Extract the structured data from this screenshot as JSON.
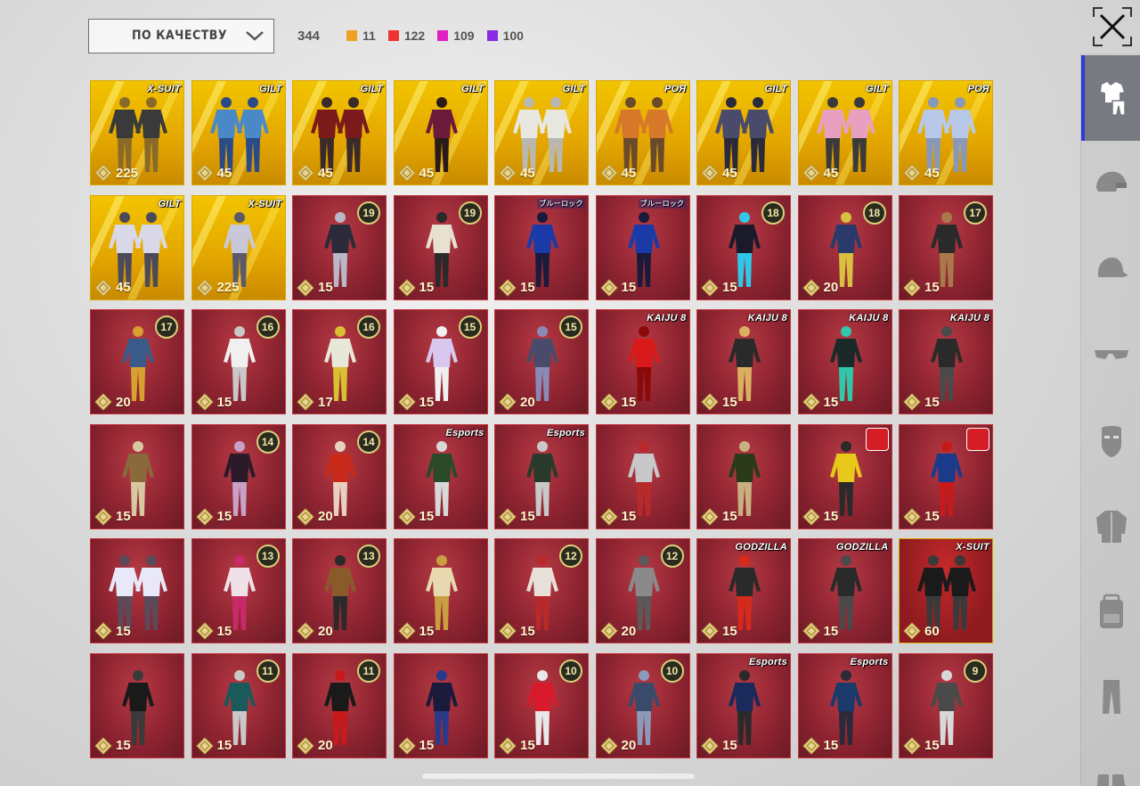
{
  "sort": {
    "label": "ПО КАЧЕСТВУ"
  },
  "stats": {
    "total": "344",
    "counts": [
      {
        "color": "#f0a020",
        "value": "11"
      },
      {
        "color": "#ee3333",
        "value": "122"
      },
      {
        "color": "#e020c0",
        "value": "109"
      },
      {
        "color": "#8a2be2",
        "value": "100"
      }
    ]
  },
  "sidebar": {
    "items": [
      {
        "icon": "outfit-icon",
        "active": true
      },
      {
        "icon": "helmet-icon",
        "active": false
      },
      {
        "icon": "cap-icon",
        "active": false
      },
      {
        "icon": "glasses-icon",
        "active": false
      },
      {
        "icon": "mask-icon",
        "active": false
      },
      {
        "icon": "jacket-icon",
        "active": false
      },
      {
        "icon": "backpack-icon",
        "active": false
      },
      {
        "icon": "pants-icon",
        "active": false
      },
      {
        "icon": "shoes-icon",
        "active": false
      }
    ]
  },
  "items": [
    {
      "price": "225",
      "tier": "gold",
      "brand": "X-SUIT",
      "brand_type": "text",
      "figures": 2,
      "colors": [
        "#3a3a3a",
        "#8a6a2a"
      ]
    },
    {
      "price": "45",
      "tier": "gold",
      "brand": "GILT",
      "brand_type": "text",
      "figures": 2,
      "colors": [
        "#4a88c8",
        "#2a4a88"
      ]
    },
    {
      "price": "45",
      "tier": "gold",
      "brand": "GILT",
      "brand_type": "text",
      "figures": 2,
      "colors": [
        "#7a1a1a",
        "#3a2a2a"
      ]
    },
    {
      "price": "45",
      "tier": "gold",
      "brand": "GILT",
      "brand_type": "text",
      "figures": 1,
      "colors": [
        "#6a1a3a",
        "#2a1a1a"
      ]
    },
    {
      "price": "45",
      "tier": "gold",
      "brand": "GILT",
      "brand_type": "text",
      "figures": 2,
      "colors": [
        "#e8e8e0",
        "#b8b8b0"
      ]
    },
    {
      "price": "45",
      "tier": "gold",
      "brand": "РОЯ",
      "brand_type": "text",
      "figures": 2,
      "colors": [
        "#d8782a",
        "#6a4a2a"
      ]
    },
    {
      "price": "45",
      "tier": "gold",
      "brand": "GILT",
      "brand_type": "text",
      "figures": 2,
      "colors": [
        "#4a4a6a",
        "#2a2a3a"
      ]
    },
    {
      "price": "45",
      "tier": "gold",
      "brand": "GILT",
      "brand_type": "text",
      "figures": 2,
      "colors": [
        "#e8a0c0",
        "#3a3a3a"
      ]
    },
    {
      "price": "45",
      "tier": "gold",
      "brand": "РОЯ",
      "brand_type": "text",
      "figures": 2,
      "colors": [
        "#b8c8e8",
        "#8898b8"
      ]
    },
    {
      "price": "45",
      "tier": "gold",
      "brand": "GILT",
      "brand_type": "text",
      "figures": 2,
      "colors": [
        "#d8d8e8",
        "#4a4a5a"
      ]
    },
    {
      "price": "225",
      "tier": "gold",
      "brand": "X-SUIT",
      "brand_type": "text",
      "figures": 1,
      "colors": [
        "#c8c8d8",
        "#5a5a6a"
      ]
    },
    {
      "price": "15",
      "tier": "red",
      "level": "19",
      "figures": 1,
      "colors": [
        "#2a2a3a",
        "#b8b8c8"
      ]
    },
    {
      "price": "15",
      "tier": "red",
      "level": "19",
      "figures": 1,
      "colors": [
        "#e8e0d0",
        "#2a2a2a"
      ]
    },
    {
      "price": "15",
      "tier": "red",
      "brand": "ブルーロック",
      "brand_type": "jp",
      "figures": 1,
      "colors": [
        "#1a3aa8",
        "#1a1a3a"
      ]
    },
    {
      "price": "15",
      "tier": "red",
      "brand": "ブルーロック",
      "brand_type": "jp",
      "figures": 1,
      "colors": [
        "#1a3aa8",
        "#1a1a3a"
      ]
    },
    {
      "price": "15",
      "tier": "red",
      "level": "18",
      "figures": 1,
      "colors": [
        "#1a1a2a",
        "#30c8e8"
      ]
    },
    {
      "price": "20",
      "tier": "red",
      "level": "18",
      "figures": 1,
      "colors": [
        "#2a3a6a",
        "#d8c040"
      ]
    },
    {
      "price": "15",
      "tier": "red",
      "level": "17",
      "figures": 1,
      "colors": [
        "#2a2a2a",
        "#a87a4a"
      ]
    },
    {
      "price": "20",
      "tier": "red",
      "level": "17",
      "figures": 1,
      "colors": [
        "#3a5a8a",
        "#d8a030"
      ]
    },
    {
      "price": "15",
      "tier": "red",
      "level": "16",
      "figures": 1,
      "colors": [
        "#f0f0f0",
        "#c8c8c8"
      ]
    },
    {
      "price": "17",
      "tier": "red",
      "level": "16",
      "figures": 1,
      "colors": [
        "#e8e8d8",
        "#d8c030"
      ]
    },
    {
      "price": "15",
      "tier": "red",
      "level": "15",
      "figures": 1,
      "colors": [
        "#d8c8f0",
        "#f0f0f0"
      ]
    },
    {
      "price": "20",
      "tier": "red",
      "level": "15",
      "figures": 1,
      "colors": [
        "#4a4a6a",
        "#8a8ab8"
      ]
    },
    {
      "price": "15",
      "tier": "red",
      "brand": "KAIJU 8",
      "brand_type": "text",
      "figures": 1,
      "colors": [
        "#d81a1a",
        "#8a0a0a"
      ]
    },
    {
      "price": "15",
      "tier": "red",
      "brand": "KAIJU 8",
      "brand_type": "text",
      "figures": 1,
      "colors": [
        "#2a2a2a",
        "#d8b060"
      ]
    },
    {
      "price": "15",
      "tier": "red",
      "brand": "KAIJU 8",
      "brand_type": "text",
      "figures": 1,
      "colors": [
        "#1a2a2a",
        "#30c8a8"
      ]
    },
    {
      "price": "15",
      "tier": "red",
      "brand": "KAIJU 8",
      "brand_type": "text",
      "figures": 1,
      "colors": [
        "#2a2a2a",
        "#4a4a4a"
      ]
    },
    {
      "price": "15",
      "tier": "red",
      "figures": 1,
      "colors": [
        "#8a6a3a",
        "#d8c8a0"
      ]
    },
    {
      "price": "15",
      "tier": "red",
      "level": "14",
      "figures": 1,
      "colors": [
        "#2a1a2a",
        "#c8a0c8"
      ]
    },
    {
      "price": "20",
      "tier": "red",
      "level": "14",
      "figures": 1,
      "colors": [
        "#c82a1a",
        "#e8d0c0"
      ]
    },
    {
      "price": "15",
      "tier": "red",
      "brand": "Esports",
      "brand_type": "text",
      "figures": 1,
      "colors": [
        "#2a4a2a",
        "#d8d8d8"
      ]
    },
    {
      "price": "15",
      "tier": "red",
      "brand": "Esports",
      "brand_type": "text",
      "figures": 1,
      "colors": [
        "#2a3a2a",
        "#c8c8c8"
      ]
    },
    {
      "price": "15",
      "tier": "red",
      "figures": 1,
      "colors": [
        "#c8c8c8",
        "#b82a2a"
      ]
    },
    {
      "price": "15",
      "tier": "red",
      "figures": 1,
      "colors": [
        "#2a3a1a",
        "#c8b080"
      ]
    },
    {
      "price": "15",
      "tier": "red",
      "brand": "transformers",
      "brand_type": "tf",
      "figures": 1,
      "colors": [
        "#e8c81a",
        "#2a2a2a"
      ]
    },
    {
      "price": "15",
      "tier": "red",
      "brand": "transformers",
      "brand_type": "tf",
      "figures": 1,
      "colors": [
        "#1a3a8a",
        "#c81a1a"
      ]
    },
    {
      "price": "15",
      "tier": "red",
      "figures": 2,
      "colors": [
        "#e8e8f8",
        "#5a4a5a"
      ]
    },
    {
      "price": "15",
      "tier": "red",
      "level": "13",
      "figures": 1,
      "colors": [
        "#f0e0e8",
        "#c82a6a"
      ]
    },
    {
      "price": "20",
      "tier": "red",
      "level": "13",
      "figures": 1,
      "colors": [
        "#8a5a2a",
        "#2a2a2a"
      ]
    },
    {
      "price": "15",
      "tier": "red",
      "figures": 1,
      "colors": [
        "#e8d8b0",
        "#c8a040"
      ]
    },
    {
      "price": "15",
      "tier": "red",
      "level": "12",
      "figures": 1,
      "colors": [
        "#e8e0d8",
        "#b82a2a"
      ]
    },
    {
      "price": "20",
      "tier": "red",
      "level": "12",
      "figures": 1,
      "colors": [
        "#8a8a8a",
        "#5a5a5a"
      ]
    },
    {
      "price": "15",
      "tier": "red",
      "brand": "GODZILLA",
      "brand_type": "text",
      "figures": 1,
      "colors": [
        "#2a2a2a",
        "#d82a1a"
      ]
    },
    {
      "price": "15",
      "tier": "red",
      "brand": "GODZILLA",
      "brand_type": "text",
      "figures": 1,
      "colors": [
        "#2a2a2a",
        "#4a4a4a"
      ]
    },
    {
      "price": "60",
      "tier": "featured",
      "brand": "X-SUIT",
      "brand_type": "text",
      "figures": 2,
      "colors": [
        "#1a1a1a",
        "#3a3a3a"
      ]
    },
    {
      "price": "15",
      "tier": "red",
      "figures": 1,
      "colors": [
        "#1a1a1a",
        "#3a3a3a"
      ]
    },
    {
      "price": "15",
      "tier": "red",
      "level": "11",
      "figures": 1,
      "colors": [
        "#1a5a5a",
        "#c8c8c8"
      ]
    },
    {
      "price": "20",
      "tier": "red",
      "level": "11",
      "figures": 1,
      "colors": [
        "#1a1a1a",
        "#c81a1a"
      ]
    },
    {
      "price": "15",
      "tier": "red",
      "figures": 1,
      "colors": [
        "#1a1a3a",
        "#2a3a8a"
      ]
    },
    {
      "price": "15",
      "tier": "red",
      "level": "10",
      "figures": 1,
      "colors": [
        "#d81a2a",
        "#e8e8e8"
      ]
    },
    {
      "price": "20",
      "tier": "red",
      "level": "10",
      "figures": 1,
      "colors": [
        "#3a4a6a",
        "#8a9ab8"
      ]
    },
    {
      "price": "15",
      "tier": "red",
      "brand": "Esports",
      "brand_type": "text",
      "figures": 1,
      "colors": [
        "#1a2a5a",
        "#2a2a2a"
      ]
    },
    {
      "price": "15",
      "tier": "red",
      "brand": "Esports",
      "brand_type": "text",
      "figures": 1,
      "colors": [
        "#1a3a6a",
        "#2a2a3a"
      ]
    },
    {
      "price": "15",
      "tier": "red",
      "level": "9",
      "figures": 1,
      "colors": [
        "#4a4a4a",
        "#d8d8d8"
      ]
    }
  ]
}
